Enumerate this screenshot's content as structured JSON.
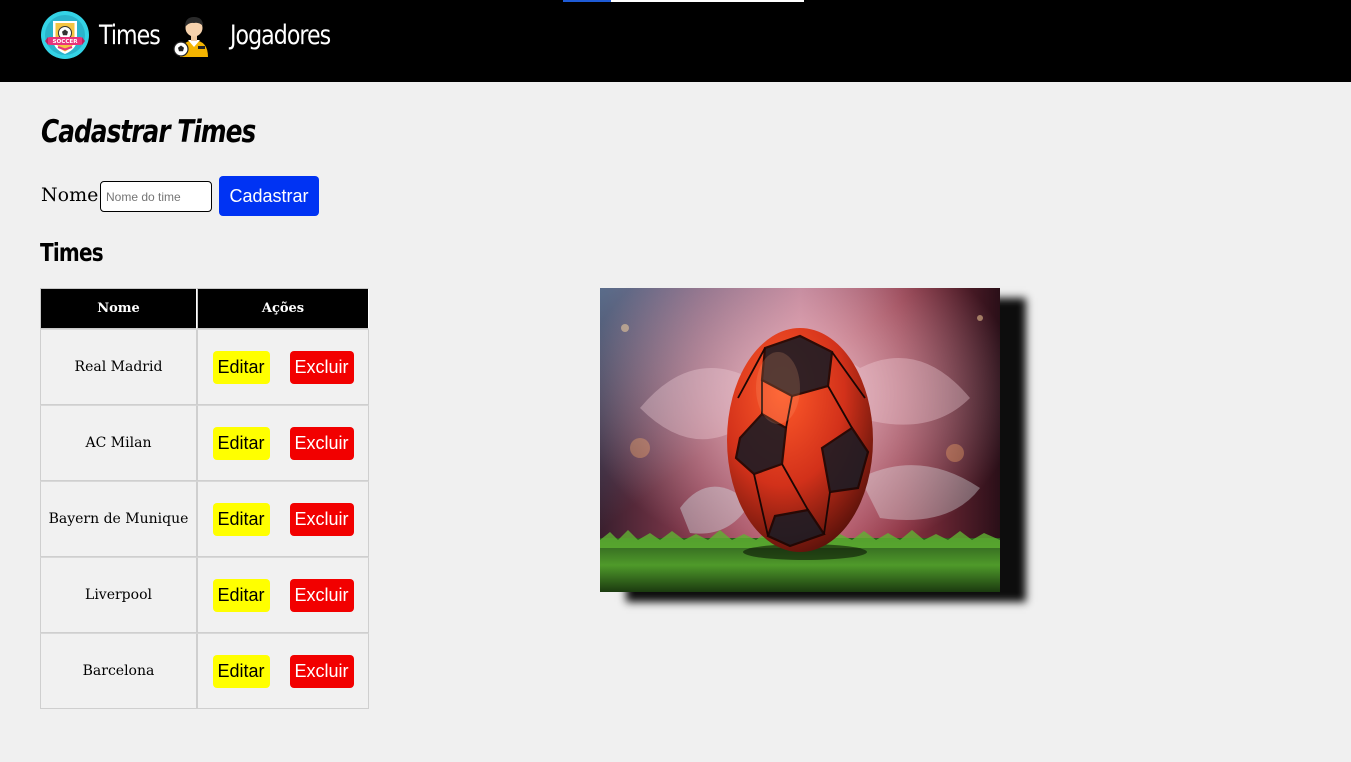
{
  "nav": {
    "items": [
      {
        "label": "Times",
        "icon": "soccer-badge-icon"
      },
      {
        "label": "Jogadores",
        "icon": "player-icon"
      }
    ],
    "top_progress": 0.2
  },
  "form": {
    "title": "Cadastrar Times",
    "name_label": "Nome",
    "name_placeholder": "Nome do time",
    "name_value": "",
    "submit_label": "Cadastrar"
  },
  "teams": {
    "title": "Times",
    "columns": [
      "Nome",
      "Ações"
    ],
    "rows": [
      {
        "name": "Real Madrid"
      },
      {
        "name": "AC Milan"
      },
      {
        "name": "Bayern de Munique"
      },
      {
        "name": "Liverpool"
      },
      {
        "name": "Barcelona"
      }
    ],
    "edit_label": "Editar",
    "delete_label": "Excluir"
  },
  "colors": {
    "header_bg": "#000000",
    "page_bg": "#f0f0f0",
    "primary_button": "#0033f3",
    "edit_button": "#ffff00",
    "delete_button": "#f20000"
  }
}
